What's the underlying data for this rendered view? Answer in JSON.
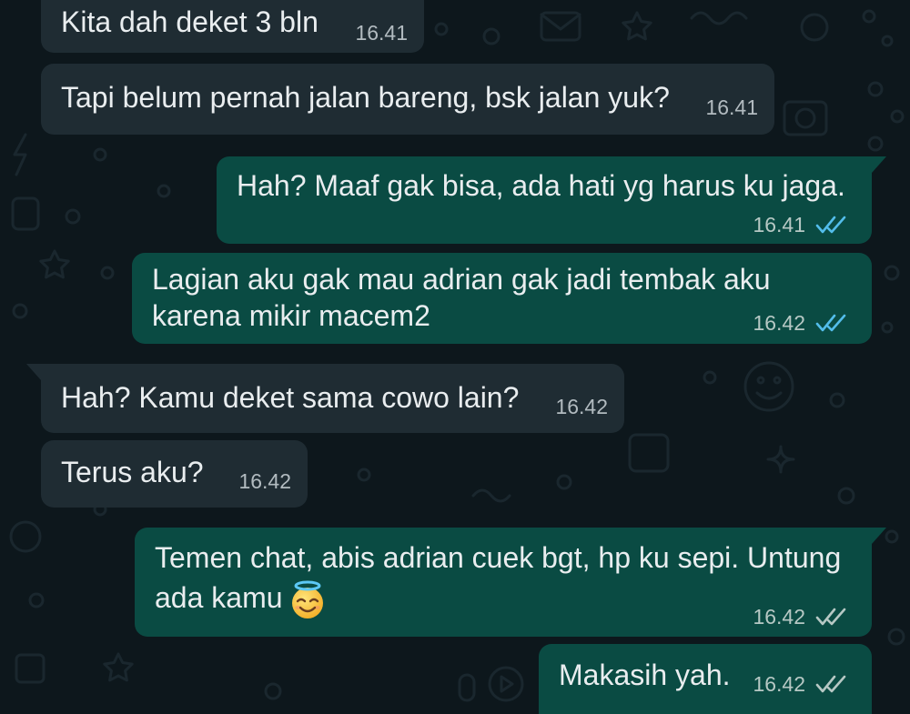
{
  "colors": {
    "background": "#0d171c",
    "doodle": "#1a272e",
    "incoming_bubble": "#1f2c33",
    "outgoing_bubble": "#0a4b43",
    "text": "#e9edef",
    "time_incoming": "#b2bbc0",
    "time_outgoing": "#b6c8c4",
    "read_tick": "#53bdeb",
    "delivered_tick": "#b6c8c4"
  },
  "messages": [
    {
      "text": "Kita dah deket 3 bln",
      "time": "16.41"
    },
    {
      "text": "Tapi belum pernah jalan bareng, bsk jalan yuk?",
      "time": "16.41"
    },
    {
      "text": "Hah? Maaf gak bisa, ada hati yg harus ku jaga.",
      "time": "16.41",
      "tick_icon": "double-check-read-icon"
    },
    {
      "lines": [
        "Lagian aku gak mau adrian gak jadi tembak aku",
        "karena mikir macem2"
      ],
      "time": "16.42",
      "tick_icon": "double-check-read-icon"
    },
    {
      "text": "Hah? Kamu deket sama cowo lain?",
      "time": "16.42"
    },
    {
      "text": "Terus aku?",
      "time": "16.42"
    },
    {
      "lines": [
        "Temen chat, abis adrian cuek bgt, hp ku sepi. Untung",
        "ada kamu"
      ],
      "emoji_icon": "smiling-face-with-halo-icon",
      "time": "16.42",
      "tick_icon": "double-check-delivered-icon"
    },
    {
      "text": "Makasih yah.",
      "time": "16.42",
      "tick_icon": "double-check-delivered-icon"
    }
  ]
}
